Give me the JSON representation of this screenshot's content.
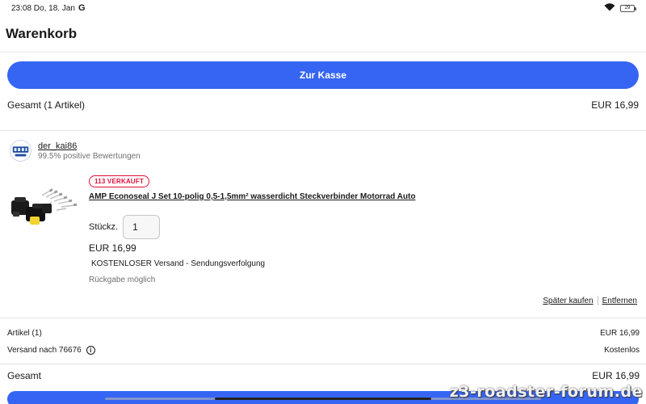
{
  "status_bar": {
    "time_date": "23:08 Do, 18. Jan",
    "app_glyph": "G",
    "battery": "29"
  },
  "header": {
    "title": "Warenkorb"
  },
  "checkout": {
    "button_label": "Zur Kasse",
    "total_label": "Gesamt (1 Artikel)",
    "total_value": "EUR 16,99"
  },
  "seller": {
    "name": "der_kai86",
    "rating": "99.5% positive Bewertungen"
  },
  "item": {
    "badge": "113 VERKAUFT",
    "title": "AMP Econoseal J Set 10-polig 0,5-1,5mm² wasserdicht Steckverbinder Motorrad Auto",
    "quantity_label": "Stückz.",
    "quantity_value": "1",
    "price": "EUR 16,99",
    "shipping": "KOSTENLOSER Versand - Sendungsverfolgung",
    "returns": "Rückgabe möglich",
    "save_later": "Später kaufen",
    "remove": "Entfernen"
  },
  "summary": {
    "items_label": "Artikel (1)",
    "items_value": "EUR 16,99",
    "shipping_label": "Versand nach 76676",
    "shipping_value": "Kostenlos",
    "total_label": "Gesamt",
    "total_value": "EUR 16,99"
  },
  "watermark": "z3-roadster-forum.de",
  "colors": {
    "accent": "#3665f3",
    "badge_red": "#e0103a",
    "muted_text": "#707070"
  },
  "icons": [
    "google-g-icon",
    "wifi-icon",
    "battery-icon",
    "info-icon"
  ]
}
